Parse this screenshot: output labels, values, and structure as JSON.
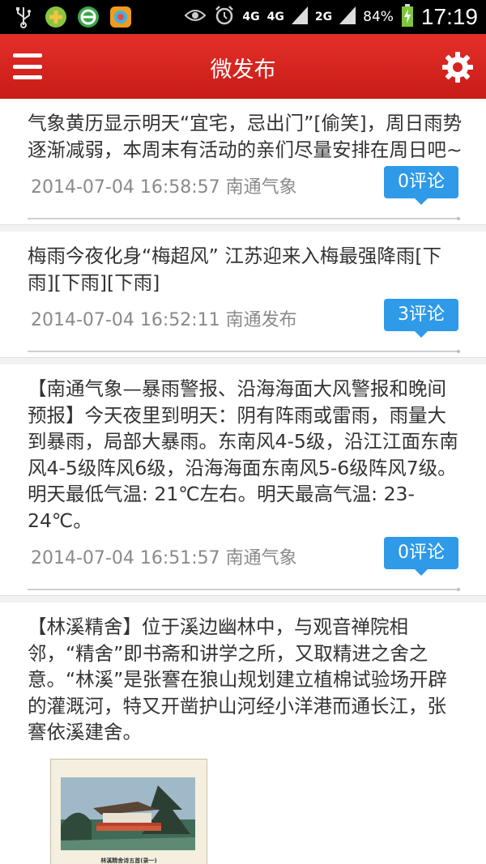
{
  "status_bar": {
    "network_1": "4G",
    "network_2": "4G",
    "network_3": "2G",
    "battery": "84%",
    "time": "17:19"
  },
  "header": {
    "title": "微发布",
    "menu_icon": "menu-icon",
    "settings_icon": "gear-icon"
  },
  "colors": {
    "header_red": "#d9261f",
    "comment_blue": "#2e9ae8"
  },
  "posts": [
    {
      "text": "气象黄历显示明天“宜宅，忌出门”[偷笑]，周日雨势逐渐减弱，本周末有活动的亲们尽量安排在周日吧~",
      "meta": "2014-07-04 16:58:57  南通气象",
      "comments": "0评论"
    },
    {
      "text": "梅雨今夜化身“梅超风” 江苏迎来入梅最强降雨[下雨][下雨][下雨]",
      "meta": "2014-07-04 16:52:11  南通发布",
      "comments": "3评论"
    },
    {
      "text": "【南通气象—暴雨警报、沿海海面大风警报和晚间预报】今天夜里到明天：阴有阵雨或雷雨，雨量大到暴雨，局部大暴雨。东南风4-5级，沿江江面东南风4-5级阵风6级，沿海海面东南风5-6级阵风7级。明天最低气温: 21℃左右。明天最高气温: 23-24℃。",
      "meta": "2014-07-04 16:51:57  南通气象",
      "comments": "0评论"
    },
    {
      "text": "【林溪精舍】位于溪边幽林中，与观音禅院相邻，“精舍”即书斋和讲学之所，又取精进之舍之意。“林溪”是张謇在狼山规划建立植棉试验场开辟的灌溉河，特又开凿护山河经小洋港而通长江，张謇依溪建舍。",
      "image_caption": "林溪精舍诗五首(录一)"
    }
  ]
}
